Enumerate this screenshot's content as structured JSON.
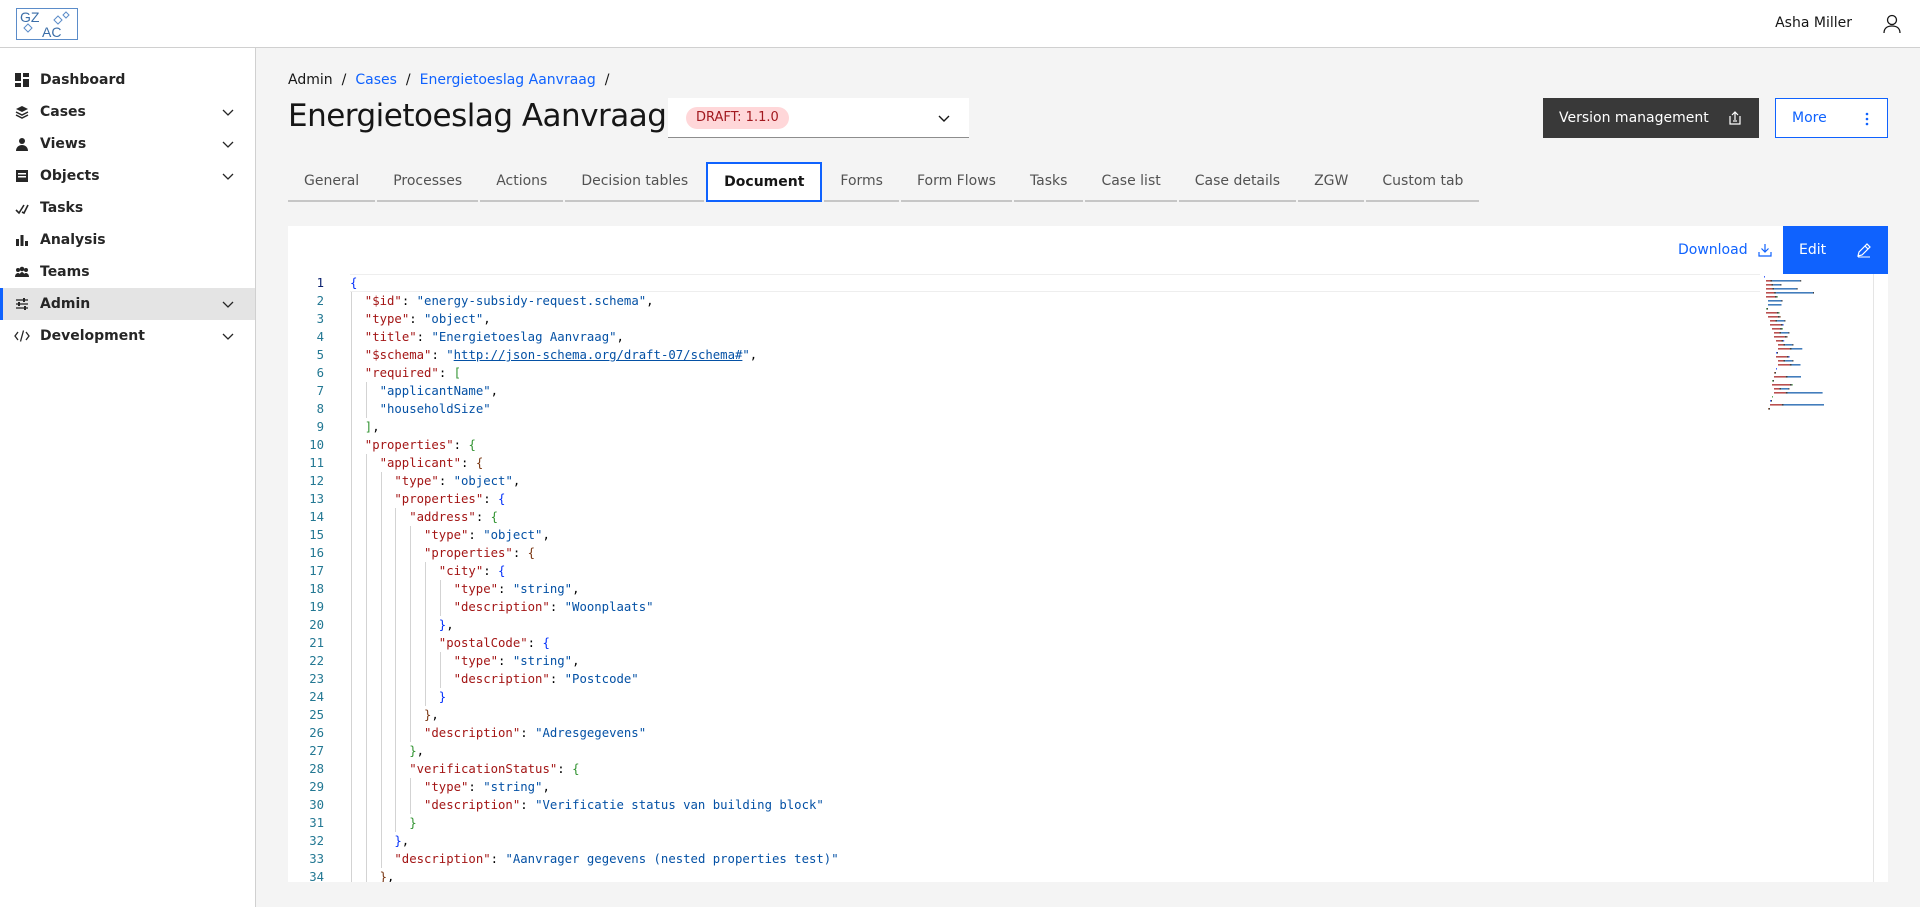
{
  "header": {
    "logo_top": "GZ",
    "logo_bottom": "AC",
    "user_name": "Asha Miller"
  },
  "sidebar": {
    "items": [
      {
        "label": "Dashboard",
        "icon": "dashboard-icon",
        "expandable": false
      },
      {
        "label": "Cases",
        "icon": "cases-icon",
        "expandable": true
      },
      {
        "label": "Views",
        "icon": "views-icon",
        "expandable": true
      },
      {
        "label": "Objects",
        "icon": "objects-icon",
        "expandable": true
      },
      {
        "label": "Tasks",
        "icon": "tasks-icon",
        "expandable": false
      },
      {
        "label": "Analysis",
        "icon": "analysis-icon",
        "expandable": false
      },
      {
        "label": "Teams",
        "icon": "teams-icon",
        "expandable": false
      },
      {
        "label": "Admin",
        "icon": "admin-icon",
        "expandable": true,
        "active": true
      },
      {
        "label": "Development",
        "icon": "development-icon",
        "expandable": true
      }
    ]
  },
  "breadcrumb": {
    "items": [
      "Admin",
      "Cases",
      "Energietoeslag Aanvraag"
    ],
    "separator": "/"
  },
  "page": {
    "title": "Energietoeslag Aanvraag",
    "version_tag": "DRAFT: 1.1.0"
  },
  "actions": {
    "version_management": "Version management",
    "more": "More",
    "download": "Download",
    "edit": "Edit"
  },
  "tabs": [
    {
      "label": "General"
    },
    {
      "label": "Processes"
    },
    {
      "label": "Actions"
    },
    {
      "label": "Decision tables"
    },
    {
      "label": "Document",
      "active": true
    },
    {
      "label": "Forms"
    },
    {
      "label": "Form Flows"
    },
    {
      "label": "Tasks"
    },
    {
      "label": "Case list"
    },
    {
      "label": "Case details"
    },
    {
      "label": "ZGW"
    },
    {
      "label": "Custom tab"
    }
  ],
  "editor": {
    "current_line": 1,
    "lines": [
      {
        "n": "1",
        "indent": 0,
        "tokens": [
          [
            "b1",
            "{"
          ]
        ]
      },
      {
        "n": "2",
        "indent": 1,
        "tokens": [
          [
            "k",
            "\"$id\""
          ],
          [
            "p",
            ": "
          ],
          [
            "s",
            "\"energy-subsidy-request.schema\""
          ],
          [
            "p",
            ","
          ]
        ]
      },
      {
        "n": "3",
        "indent": 1,
        "tokens": [
          [
            "k",
            "\"type\""
          ],
          [
            "p",
            ": "
          ],
          [
            "s",
            "\"object\""
          ],
          [
            "p",
            ","
          ]
        ]
      },
      {
        "n": "4",
        "indent": 1,
        "tokens": [
          [
            "k",
            "\"title\""
          ],
          [
            "p",
            ": "
          ],
          [
            "s",
            "\"Energietoeslag Aanvraag\""
          ],
          [
            "p",
            ","
          ]
        ]
      },
      {
        "n": "5",
        "indent": 1,
        "tokens": [
          [
            "k",
            "\"$schema\""
          ],
          [
            "p",
            ": "
          ],
          [
            "s",
            "\""
          ],
          [
            "su",
            "http://json-schema.org/draft-07/schema#"
          ],
          [
            "s",
            "\""
          ],
          [
            "p",
            ","
          ]
        ]
      },
      {
        "n": "6",
        "indent": 1,
        "tokens": [
          [
            "k",
            "\"required\""
          ],
          [
            "p",
            ": "
          ],
          [
            "b2",
            "["
          ]
        ]
      },
      {
        "n": "7",
        "indent": 2,
        "tokens": [
          [
            "s",
            "\"applicantName\""
          ],
          [
            "p",
            ","
          ]
        ]
      },
      {
        "n": "8",
        "indent": 2,
        "tokens": [
          [
            "s",
            "\"householdSize\""
          ]
        ]
      },
      {
        "n": "9",
        "indent": 1,
        "tokens": [
          [
            "b2",
            "]"
          ],
          [
            "p",
            ","
          ]
        ]
      },
      {
        "n": "10",
        "indent": 1,
        "tokens": [
          [
            "k",
            "\"properties\""
          ],
          [
            "p",
            ": "
          ],
          [
            "b2",
            "{"
          ]
        ]
      },
      {
        "n": "11",
        "indent": 2,
        "tokens": [
          [
            "k",
            "\"applicant\""
          ],
          [
            "p",
            ": "
          ],
          [
            "b3",
            "{"
          ]
        ]
      },
      {
        "n": "12",
        "indent": 3,
        "tokens": [
          [
            "k",
            "\"type\""
          ],
          [
            "p",
            ": "
          ],
          [
            "s",
            "\"object\""
          ],
          [
            "p",
            ","
          ]
        ]
      },
      {
        "n": "13",
        "indent": 3,
        "tokens": [
          [
            "k",
            "\"properties\""
          ],
          [
            "p",
            ": "
          ],
          [
            "b1",
            "{"
          ]
        ]
      },
      {
        "n": "14",
        "indent": 4,
        "tokens": [
          [
            "k",
            "\"address\""
          ],
          [
            "p",
            ": "
          ],
          [
            "b2",
            "{"
          ]
        ]
      },
      {
        "n": "15",
        "indent": 5,
        "tokens": [
          [
            "k",
            "\"type\""
          ],
          [
            "p",
            ": "
          ],
          [
            "s",
            "\"object\""
          ],
          [
            "p",
            ","
          ]
        ]
      },
      {
        "n": "16",
        "indent": 5,
        "tokens": [
          [
            "k",
            "\"properties\""
          ],
          [
            "p",
            ": "
          ],
          [
            "b3",
            "{"
          ]
        ]
      },
      {
        "n": "17",
        "indent": 6,
        "tokens": [
          [
            "k",
            "\"city\""
          ],
          [
            "p",
            ": "
          ],
          [
            "b1",
            "{"
          ]
        ]
      },
      {
        "n": "18",
        "indent": 7,
        "tokens": [
          [
            "k",
            "\"type\""
          ],
          [
            "p",
            ": "
          ],
          [
            "s",
            "\"string\""
          ],
          [
            "p",
            ","
          ]
        ]
      },
      {
        "n": "19",
        "indent": 7,
        "tokens": [
          [
            "k",
            "\"description\""
          ],
          [
            "p",
            ": "
          ],
          [
            "s",
            "\"Woonplaats\""
          ]
        ]
      },
      {
        "n": "20",
        "indent": 6,
        "tokens": [
          [
            "b1",
            "}"
          ],
          [
            "p",
            ","
          ]
        ]
      },
      {
        "n": "21",
        "indent": 6,
        "tokens": [
          [
            "k",
            "\"postalCode\""
          ],
          [
            "p",
            ": "
          ],
          [
            "b1",
            "{"
          ]
        ]
      },
      {
        "n": "22",
        "indent": 7,
        "tokens": [
          [
            "k",
            "\"type\""
          ],
          [
            "p",
            ": "
          ],
          [
            "s",
            "\"string\""
          ],
          [
            "p",
            ","
          ]
        ]
      },
      {
        "n": "23",
        "indent": 7,
        "tokens": [
          [
            "k",
            "\"description\""
          ],
          [
            "p",
            ": "
          ],
          [
            "s",
            "\"Postcode\""
          ]
        ]
      },
      {
        "n": "24",
        "indent": 6,
        "tokens": [
          [
            "b1",
            "}"
          ]
        ]
      },
      {
        "n": "25",
        "indent": 5,
        "tokens": [
          [
            "b3",
            "}"
          ],
          [
            "p",
            ","
          ]
        ]
      },
      {
        "n": "26",
        "indent": 5,
        "tokens": [
          [
            "k",
            "\"description\""
          ],
          [
            "p",
            ": "
          ],
          [
            "s",
            "\"Adresgegevens\""
          ]
        ]
      },
      {
        "n": "27",
        "indent": 4,
        "tokens": [
          [
            "b2",
            "}"
          ],
          [
            "p",
            ","
          ]
        ]
      },
      {
        "n": "28",
        "indent": 4,
        "tokens": [
          [
            "k",
            "\"verificationStatus\""
          ],
          [
            "p",
            ": "
          ],
          [
            "b2",
            "{"
          ]
        ]
      },
      {
        "n": "29",
        "indent": 5,
        "tokens": [
          [
            "k",
            "\"type\""
          ],
          [
            "p",
            ": "
          ],
          [
            "s",
            "\"string\""
          ],
          [
            "p",
            ","
          ]
        ]
      },
      {
        "n": "30",
        "indent": 5,
        "tokens": [
          [
            "k",
            "\"description\""
          ],
          [
            "p",
            ": "
          ],
          [
            "s",
            "\"Verificatie status van building block\""
          ]
        ]
      },
      {
        "n": "31",
        "indent": 4,
        "tokens": [
          [
            "b2",
            "}"
          ]
        ]
      },
      {
        "n": "32",
        "indent": 3,
        "tokens": [
          [
            "b1",
            "}"
          ],
          [
            "p",
            ","
          ]
        ]
      },
      {
        "n": "33",
        "indent": 3,
        "tokens": [
          [
            "k",
            "\"description\""
          ],
          [
            "p",
            ": "
          ],
          [
            "s",
            "\"Aanvrager gegevens (nested properties test)\""
          ]
        ]
      },
      {
        "n": "34",
        "indent": 2,
        "tokens": [
          [
            "b3",
            "}"
          ],
          [
            "p",
            ","
          ]
        ]
      }
    ]
  },
  "colors": {
    "accent": "#0f62fe",
    "dark_button": "#393939",
    "draft_tag_bg": "#ffd7d9",
    "draft_tag_text": "#a2191f",
    "json_key": "#a31515",
    "json_string": "#0451a5"
  }
}
